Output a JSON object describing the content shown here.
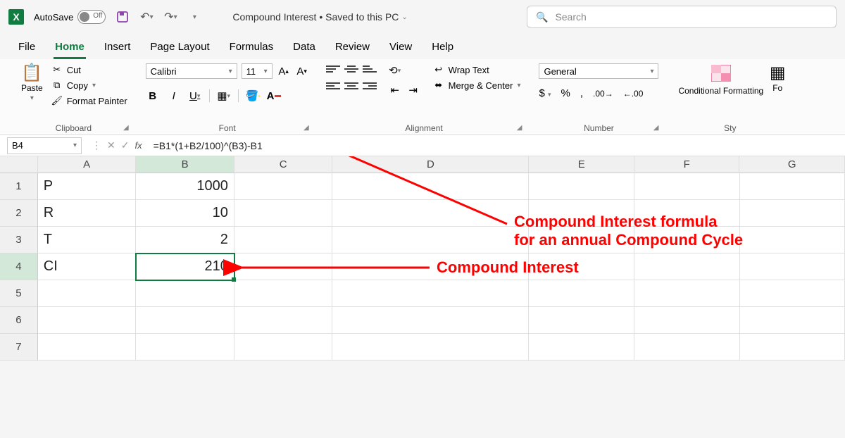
{
  "titlebar": {
    "autosave_label": "AutoSave",
    "autosave_state": "Off",
    "doc_title": "Compound Interest • Saved to this PC",
    "search_placeholder": "Search"
  },
  "tabs": [
    "File",
    "Home",
    "Insert",
    "Page Layout",
    "Formulas",
    "Data",
    "Review",
    "View",
    "Help"
  ],
  "active_tab": "Home",
  "ribbon": {
    "clipboard": {
      "paste": "Paste",
      "cut": "Cut",
      "copy": "Copy",
      "format_painter": "Format Painter",
      "label": "Clipboard"
    },
    "font": {
      "name": "Calibri",
      "size": "11",
      "label": "Font"
    },
    "alignment": {
      "wrap": "Wrap Text",
      "merge": "Merge & Center",
      "label": "Alignment"
    },
    "number": {
      "format": "General",
      "label": "Number"
    },
    "styles": {
      "cond": "Conditional Formatting",
      "fmt_table": "Fo",
      "label": "Sty"
    }
  },
  "formula_bar": {
    "cell_ref": "B4",
    "formula": "=B1*(1+B2/100)^(B3)-B1"
  },
  "grid": {
    "columns": [
      "A",
      "B",
      "C",
      "D",
      "E",
      "F",
      "G"
    ],
    "rows": [
      {
        "n": "1",
        "A": "P",
        "B": "1000"
      },
      {
        "n": "2",
        "A": "R",
        "B": "10"
      },
      {
        "n": "3",
        "A": "T",
        "B": "2"
      },
      {
        "n": "4",
        "A": "CI",
        "B": "210"
      },
      {
        "n": "5",
        "A": "",
        "B": ""
      },
      {
        "n": "6",
        "A": "",
        "B": ""
      },
      {
        "n": "7",
        "A": "",
        "B": ""
      }
    ],
    "selected": "B4"
  },
  "annotations": {
    "a1_line1": "Compound Interest formula",
    "a1_line2": "for an annual Compound Cycle",
    "a2": "Compound Interest"
  },
  "colors": {
    "accent": "#107c41",
    "annot": "#ff0000"
  }
}
